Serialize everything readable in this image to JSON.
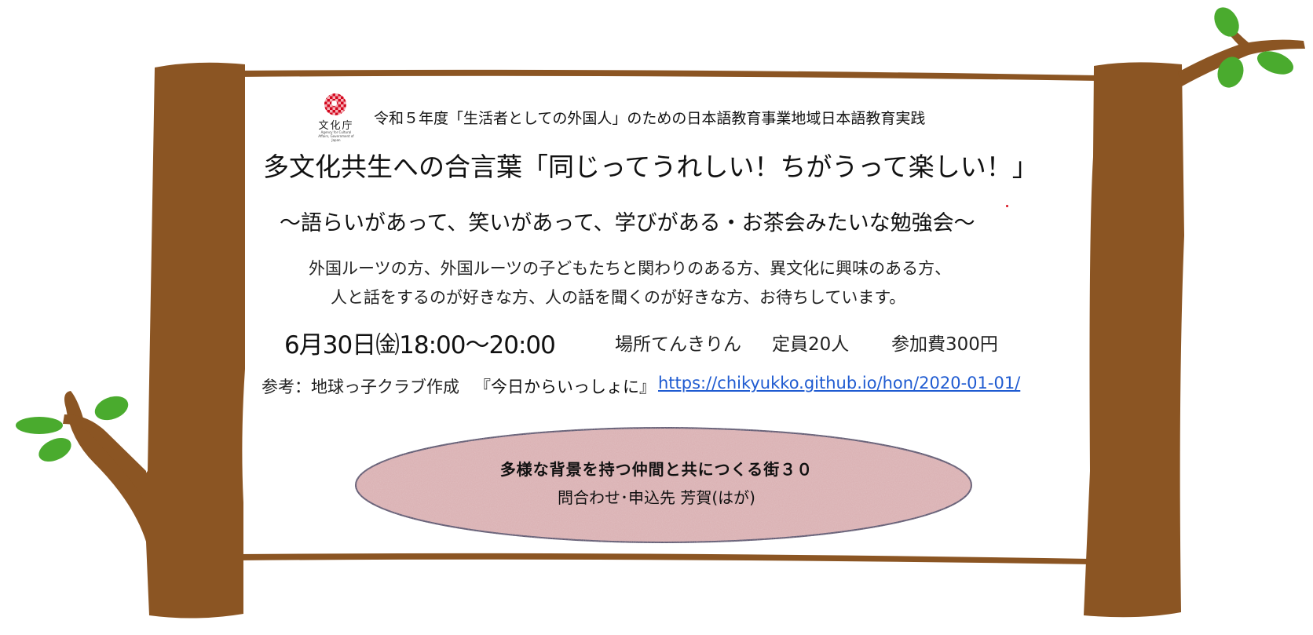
{
  "header": {
    "logo_text": "文化庁",
    "logo_subtext": "Agency for Cultural Affairs, Government of Japan",
    "subtitle": "令和５年度「生活者としての外国人」のための日本語教育事業地域日本語教育実践"
  },
  "title": "多文化共生への合言葉「同じってうれしい！ちがうって楽しい！」",
  "tagline": "～語らいがあって、笑いがあって、学びがある・お茶会みたいな勉強会～",
  "description": {
    "line1": "外国ルーツの方、外国ルーツの子どもたちと関わりのある方、異文化に興味のある方、",
    "line2": "人と話をするのが好きな方、人の話を聞くのが好きな方、お待ちしています。"
  },
  "event": {
    "datetime": "6月30日㈮18:00～20:00",
    "place": "場所てんきりん",
    "capacity": "定員20人",
    "fee": "参加費300円"
  },
  "reference": {
    "label": "参考：地球っ子クラブ作成",
    "book": "『今日からいっしょに』",
    "link": "https://chikyukko.github.io/hon/2020-01-01/"
  },
  "oval": {
    "organization": "多様な背景を持つ仲間と共につくる街３０",
    "contact": "問合わせ･申込先  芳賀(はが)"
  },
  "colors": {
    "trunk": "#8b5523",
    "leaf": "#4aab2e",
    "oval_fill": "#d9aeb0",
    "oval_stroke": "#1f2a5a",
    "link": "#1f5bd1",
    "logo_red": "#d3061d"
  }
}
